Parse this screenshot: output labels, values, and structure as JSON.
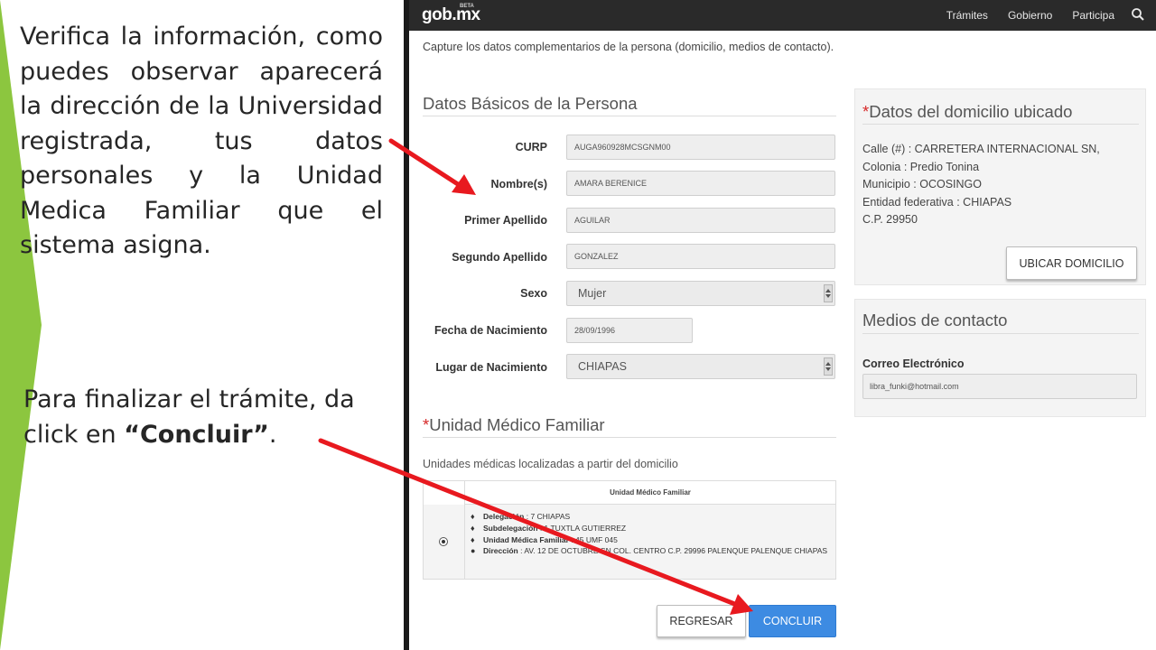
{
  "slide": {
    "text1": "Verifica la información, como puedes observar aparecerá la dirección de la Universidad registrada, tus datos personales y la Unidad Medica Familiar que el sistema asigna.",
    "text2_prefix": "Para finalizar el trámite, da click en ",
    "text2_bold": "“Concluir”",
    "text2_suffix": "."
  },
  "navbar": {
    "logo": "gob.mx",
    "logo_badge": "BETA",
    "links": [
      "Trámites",
      "Gobierno",
      "Participa"
    ],
    "search_icon": "search-icon"
  },
  "page": {
    "subtitle": "Capture los datos complementarios de la persona (domicilio, medios de contacto)."
  },
  "basic_data": {
    "title": "Datos Básicos de la Persona",
    "fields": {
      "curp": {
        "label": "CURP",
        "value": "AUGA960928MCSGNM00"
      },
      "nombre": {
        "label": "Nombre(s)",
        "value": "AMARA BERENICE"
      },
      "primer_apellido": {
        "label": "Primer Apellido",
        "value": "AGUILAR"
      },
      "segundo_apellido": {
        "label": "Segundo Apellido",
        "value": "GONZALEZ"
      },
      "sexo": {
        "label": "Sexo",
        "value": "Mujer"
      },
      "fecha_nacimiento": {
        "label": "Fecha de Nacimiento",
        "value": "28/09/1996"
      },
      "lugar_nacimiento": {
        "label": "Lugar de Nacimiento",
        "value": "CHIAPAS"
      }
    }
  },
  "umf": {
    "required_mark": "*",
    "title": "Unidad Médico Familiar",
    "description": "Unidades médicas localizadas a partir del domicilio",
    "table_header": "Unidad Médico Familiar",
    "rows": [
      {
        "icon": "tag-icon",
        "label": "Delegación",
        "value": " : 7 CHIAPAS"
      },
      {
        "icon": "tag-icon",
        "label": "Subdelegación",
        "value": " : 1 TUXTLA GUTIERREZ"
      },
      {
        "icon": "tag-icon",
        "label": "Unidad Médica Familiar",
        "value": " : 45 UMF 045"
      },
      {
        "icon": "globe-icon",
        "label": "Dirección",
        "value": " : AV. 12 DE OCTUBRE SN COL. CENTRO C.P. 29996 PALENQUE PALENQUE CHIAPAS"
      }
    ]
  },
  "buttons": {
    "back": "REGRESAR",
    "done": "CONCLUIR",
    "done_color": "#3d8be2"
  },
  "address_panel": {
    "required_mark": "*",
    "title": "Datos del domicilio ubicado",
    "lines": [
      "Calle (#) : CARRETERA INTERNACIONAL SN,",
      "Colonia : Predio Tonina",
      "Municipio : OCOSINGO",
      "Entidad federativa : CHIAPAS",
      "C.P. 29950"
    ],
    "locate_button": "UBICAR DOMICILIO"
  },
  "contact_panel": {
    "title": "Medios de contacto",
    "email_label": "Correo Electrónico",
    "email_value": "libra_funki@hotmail.com"
  },
  "colors": {
    "accent_green": "#8cc63f",
    "required_red": "#d62b2b",
    "arrow_red": "#e8191f",
    "navbar": "#2a2a2a"
  }
}
